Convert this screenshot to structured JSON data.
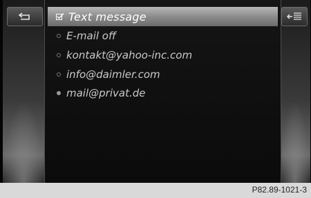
{
  "header": {
    "title": "Text message",
    "icon": "check-icon"
  },
  "left_button": {
    "icon": "back-arrow-icon"
  },
  "right_button": {
    "icon": "menu-icon"
  },
  "options": [
    {
      "label": "E-mail off",
      "selected": false
    },
    {
      "label": "kontakt@yahoo-inc.com",
      "selected": false
    },
    {
      "label": "info@daimler.com",
      "selected": false
    },
    {
      "label": "mail@privat.de",
      "selected": true
    }
  ],
  "footer": {
    "reference": "P82.89-1021-3"
  }
}
